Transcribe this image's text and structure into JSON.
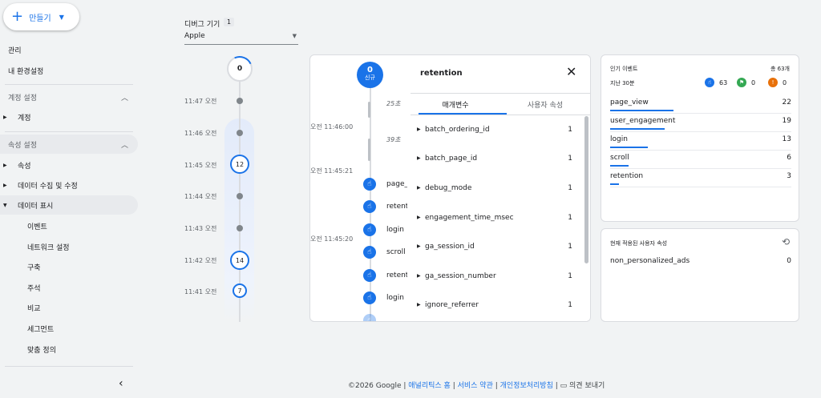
{
  "create": {
    "label": "만들기"
  },
  "sidebar": {
    "admin": "관리",
    "prefs": "내 환경설정",
    "account_settings": "계정 설정",
    "account": "계정",
    "property_settings": "속성 설정",
    "property": "속성",
    "data_collection": "데이터 수집 및 수정",
    "data_display": "데이터 표시",
    "sub": [
      "이벤트",
      "네트워크 설정",
      "구축",
      "주석",
      "비교",
      "세그먼트",
      "맞춤 정의"
    ]
  },
  "device": {
    "label": "디버그 기기",
    "count": "1",
    "selected": "Apple"
  },
  "timeline": {
    "top_count": "0",
    "times": [
      "11:47 오전",
      "11:46 오전",
      "11:45 오전",
      "11:44 오전",
      "11:43 오전",
      "11:42 오전",
      "11:41 오전"
    ],
    "counts": {
      "t1145": "12",
      "t1142": "14",
      "t1141": "7"
    }
  },
  "stream": {
    "new_count": "0",
    "new_label": "신규",
    "gap1": "25초",
    "gap2": "39초",
    "sec1": "오전 11:46:00",
    "sec2": "오전 11:45:21",
    "sec3": "오전 11:45:20",
    "events": [
      "page_",
      "retent",
      "login",
      "scroll",
      "retent",
      "login"
    ]
  },
  "panel": {
    "title": "retention",
    "tab_params": "매개변수",
    "tab_user": "사용자 속성",
    "params": [
      {
        "name": "batch_ordering_id",
        "value": "1"
      },
      {
        "name": "batch_page_id",
        "value": "1"
      },
      {
        "name": "debug_mode",
        "value": "1"
      },
      {
        "name": "engagement_time_msec",
        "value": "1"
      },
      {
        "name": "ga_session_id",
        "value": "1"
      },
      {
        "name": "ga_session_number",
        "value": "1"
      },
      {
        "name": "ignore_referrer",
        "value": "1"
      }
    ]
  },
  "top_events": {
    "title": "인기 이벤트",
    "total": "총 63개",
    "range": "지난 30분",
    "stat_events": "63",
    "stat_conversions": "0",
    "stat_errors": "0",
    "rows": [
      {
        "name": "page_view",
        "value": "22",
        "share": 0.35
      },
      {
        "name": "user_engagement",
        "value": "19",
        "share": 0.3
      },
      {
        "name": "login",
        "value": "13",
        "share": 0.21
      },
      {
        "name": "scroll",
        "value": "6",
        "share": 0.1
      },
      {
        "name": "retention",
        "value": "3",
        "share": 0.05
      }
    ]
  },
  "user_props": {
    "title": "현재 적용된 사용자 속성",
    "rows": [
      {
        "name": "non_personalized_ads",
        "value": "0"
      }
    ]
  },
  "footer": {
    "copyright": "©2026 Google",
    "home": "애널리틱스 홈",
    "terms": "서비스 약관",
    "privacy": "개인정보처리방침",
    "feedback": "의견 보내기",
    "sep": " | "
  },
  "colors": {
    "accent": "#1a73e8",
    "conversion": "#34a853",
    "error": "#e8710a"
  }
}
